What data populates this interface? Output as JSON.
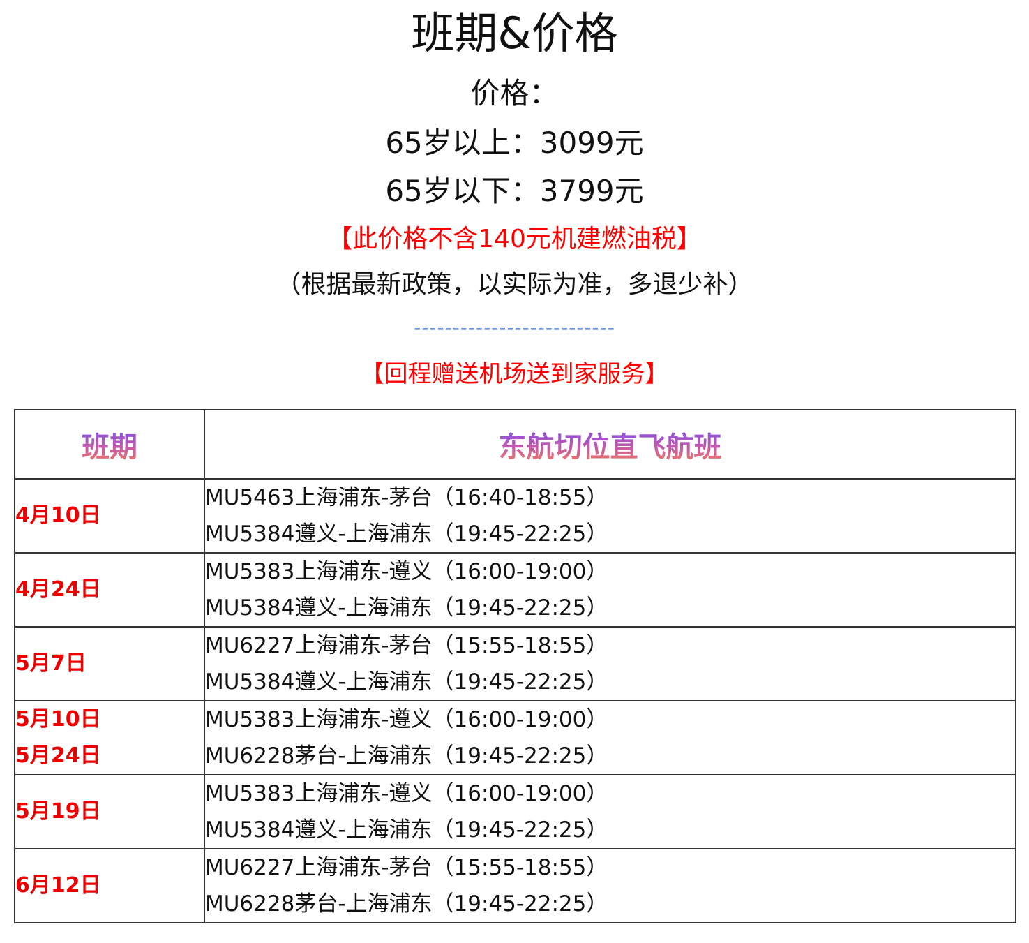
{
  "title": "班期&价格",
  "price": {
    "label": "价格：",
    "senior": "65岁以上：3099元",
    "adult": "65岁以下：3799元"
  },
  "notice_tax": "【此价格不含140元机建燃油税】",
  "notice_policy": "（根据最新政策，以实际为准，多退少补）",
  "divider": "--------------------------",
  "notice_service": "【回程赠送机场送到家服务】",
  "table": {
    "headers": [
      "班期",
      "东航切位直飞航班"
    ],
    "rows": [
      {
        "dates": [
          "4月10日"
        ],
        "flights": [
          "MU5463上海浦东-茅台（16:40-18:55）",
          "MU5384遵义-上海浦东（19:45-22:25）"
        ]
      },
      {
        "dates": [
          "4月24日"
        ],
        "flights": [
          "MU5383上海浦东-遵义（16:00-19:00）",
          "MU5384遵义-上海浦东（19:45-22:25）"
        ]
      },
      {
        "dates": [
          "5月7日"
        ],
        "flights": [
          "MU6227上海浦东-茅台（15:55-18:55）",
          "MU5384遵义-上海浦东（19:45-22:25）"
        ]
      },
      {
        "dates": [
          "5月10日",
          "5月24日"
        ],
        "flights": [
          "MU5383上海浦东-遵义（16:00-19:00）",
          "MU6228茅台-上海浦东（19:45-22:25）"
        ]
      },
      {
        "dates": [
          "5月19日"
        ],
        "flights": [
          "MU5383上海浦东-遵义（16:00-19:00）",
          "MU5384遵义-上海浦东（19:45-22:25）"
        ]
      },
      {
        "dates": [
          "6月12日"
        ],
        "flights": [
          "MU6227上海浦东-茅台（15:55-18:55）",
          "MU6228茅台-上海浦东（19:45-22:25）"
        ]
      }
    ]
  },
  "colors": {
    "notice_red": "#ff0000",
    "date_red": "#ee0000",
    "divider_blue": "#2f6bd8",
    "header_gradient": [
      "#8b4fe0",
      "#f07a5e"
    ]
  }
}
